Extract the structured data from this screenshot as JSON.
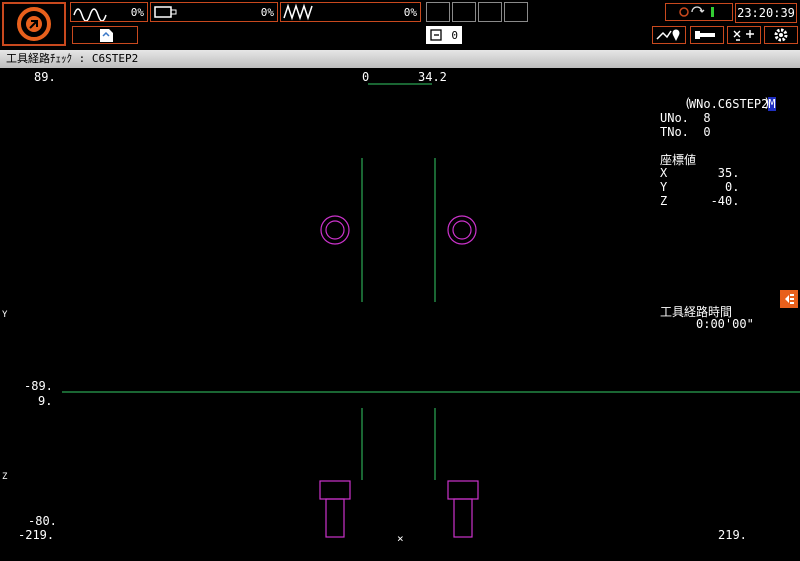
{
  "header": {
    "spindle_load_1": "0%",
    "spindle_load_2": "0%",
    "spindle_load_3": "0%",
    "counter_value": "0",
    "clock": "23:20:39"
  },
  "titlebar": {
    "title": "工具経路ﾁｪｯｸ : C6STEP2"
  },
  "view": {
    "top_y_value": "89.",
    "scale_left": "0",
    "scale_right": "34.2",
    "y_axis_label": "Y",
    "z_axis_label": "Z",
    "mid_upper_value": "-89.",
    "mid_lower_value": "9.",
    "bottom_values_1": "-80.",
    "bottom_values_2": "-219.",
    "bottom_right_value": "219.",
    "origin_mark": "×"
  },
  "info": {
    "wno_label": "WNo.C6STEP2",
    "wno_cursor": "M",
    "paren_line": "(          )",
    "uno": "UNo.  8",
    "tno": "TNo.  0",
    "coord_header": "座標値",
    "x_line": "X       35.",
    "y_line": "Y        0.",
    "z_line": "Z      -40.",
    "time_header": "工具経路時間",
    "time_value": "0:00'00\""
  },
  "colors": {
    "accent": "#e8601c",
    "toolpath_green": "#33cc66",
    "tool_magenta": "#cc33cc",
    "scale_green": "#33cc66"
  }
}
